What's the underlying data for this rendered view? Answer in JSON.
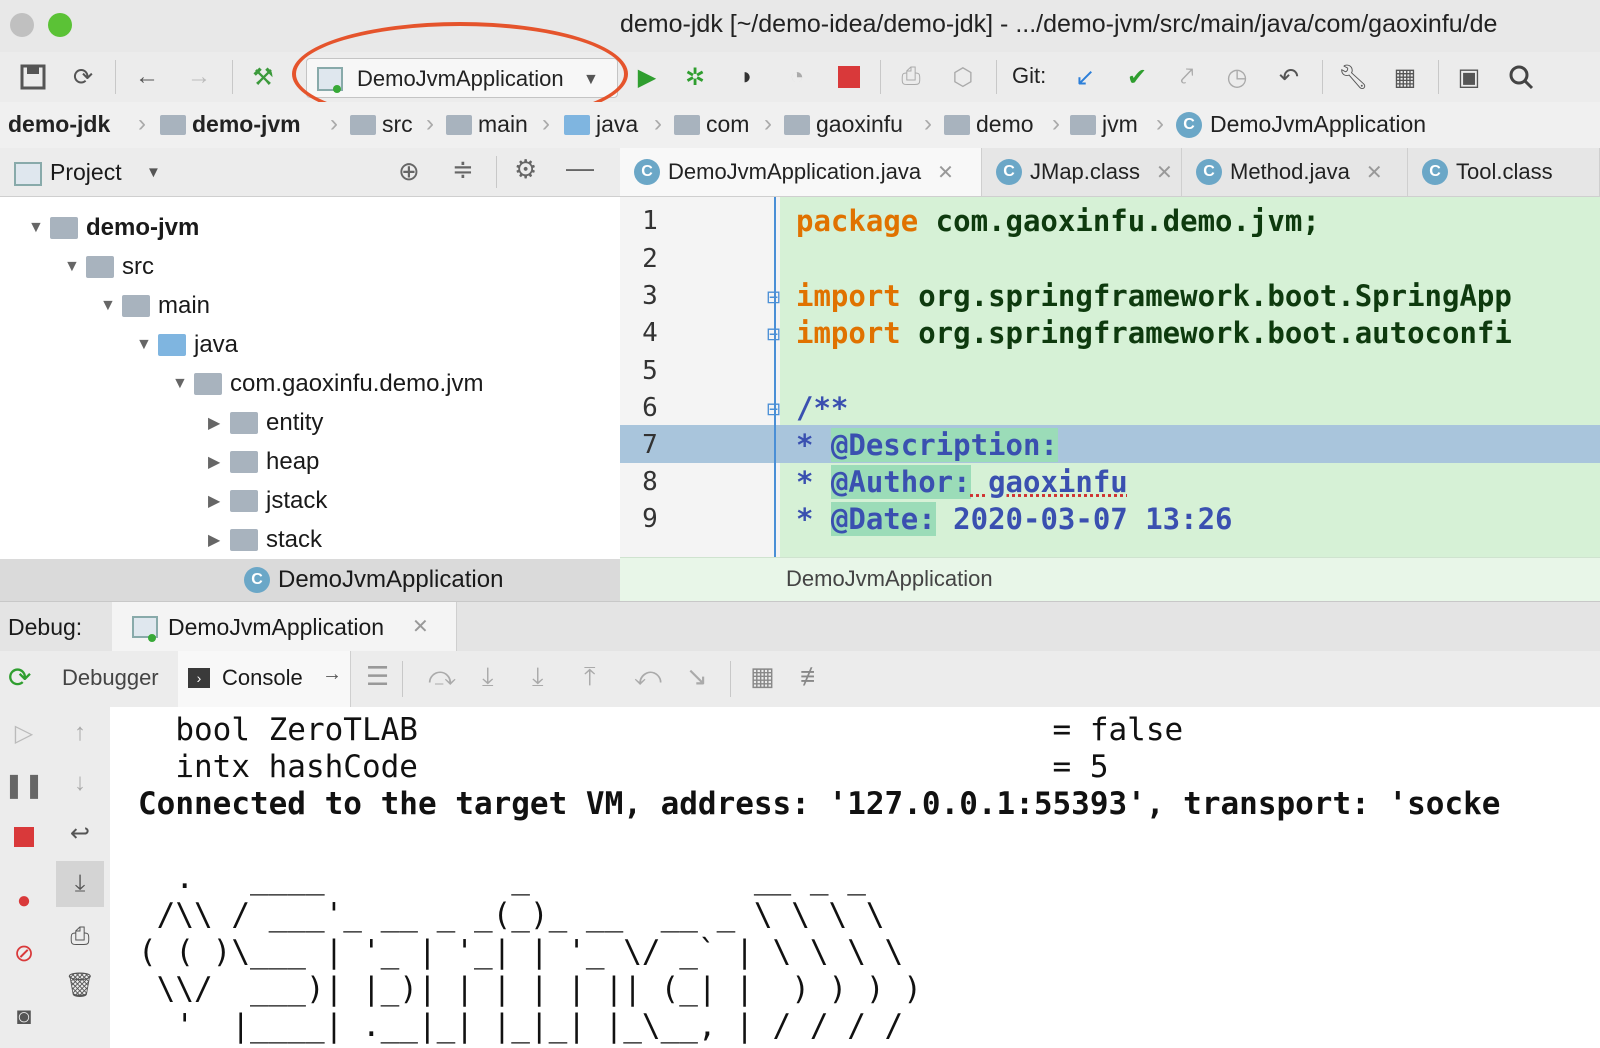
{
  "window": {
    "title": "demo-jdk [~/demo-idea/demo-jdk] - .../demo-jvm/src/main/java/com/gaoxinfu/de"
  },
  "toolbar": {
    "run_config": "DemoJvmApplication",
    "git_label": "Git:"
  },
  "breadcrumb": [
    "demo-jdk",
    "demo-jvm",
    "src",
    "main",
    "java",
    "com",
    "gaoxinfu",
    "demo",
    "jvm",
    "DemoJvmApplication"
  ],
  "project": {
    "header": "Project",
    "tree": [
      {
        "label": "demo-jvm",
        "depth": 1,
        "expanded": true,
        "bold": true
      },
      {
        "label": "src",
        "depth": 2,
        "expanded": true
      },
      {
        "label": "main",
        "depth": 3,
        "expanded": true
      },
      {
        "label": "java",
        "depth": 4,
        "expanded": true
      },
      {
        "label": "com.gaoxinfu.demo.jvm",
        "depth": 5,
        "expanded": true
      },
      {
        "label": "entity",
        "depth": 6,
        "expanded": false
      },
      {
        "label": "heap",
        "depth": 6,
        "expanded": false
      },
      {
        "label": "jstack",
        "depth": 6,
        "expanded": false
      },
      {
        "label": "stack",
        "depth": 6,
        "expanded": false
      },
      {
        "label": "DemoJvmApplication",
        "depth": 6
      }
    ]
  },
  "editor": {
    "tabs": [
      {
        "label": "DemoJvmApplication.java",
        "active": true
      },
      {
        "label": "JMap.class",
        "active": false
      },
      {
        "label": "Method.java",
        "active": false
      },
      {
        "label": "Tool.class",
        "active": false
      }
    ],
    "line_numbers": [
      "1",
      "2",
      "3",
      "4",
      "5",
      "6",
      "7",
      "8",
      "9"
    ],
    "code": {
      "l1_kw": "package",
      "l1_rest": " com.gaoxinfu.demo.jvm;",
      "l3_kw": "import",
      "l3_rest": " org.springframework.boot.SpringApp",
      "l4_kw": "import",
      "l4_rest": " org.springframework.boot.autoconfi",
      "l6": "/**",
      "l7_star": " * ",
      "l7_tag": "@Description:",
      "l8_star": " * ",
      "l8_tag": "@Author:",
      "l8_val": " gaoxinfu",
      "l9_star": " * ",
      "l9_tag": "@Date:",
      "l9_val": " 2020-03-07 13:26"
    },
    "footer_crumb": "DemoJvmApplication"
  },
  "debug": {
    "label": "Debug:",
    "session": "DemoJvmApplication",
    "tab_debugger": "Debugger",
    "tab_console": "Console"
  },
  "console": {
    "lines": [
      "  bool ZeroTLAB                                  = false",
      "  intx hashCode                                  = 5",
      "Connected to the target VM, address: '127.0.0.1:55393', transport: 'socke",
      "",
      "  .   ____          _            __ _ _",
      " /\\\\ / ___'_ __ _ _(_)_ __  __ _ \\ \\ \\ \\",
      "( ( )\\___ | '_ | '_| | '_ \\/ _` | \\ \\ \\ \\",
      " \\\\/  ___)| |_)| | | | | || (_| |  ) ) ) )",
      "  '  |____| .__|_| |_|_| |_\\__, | / / / /"
    ]
  }
}
